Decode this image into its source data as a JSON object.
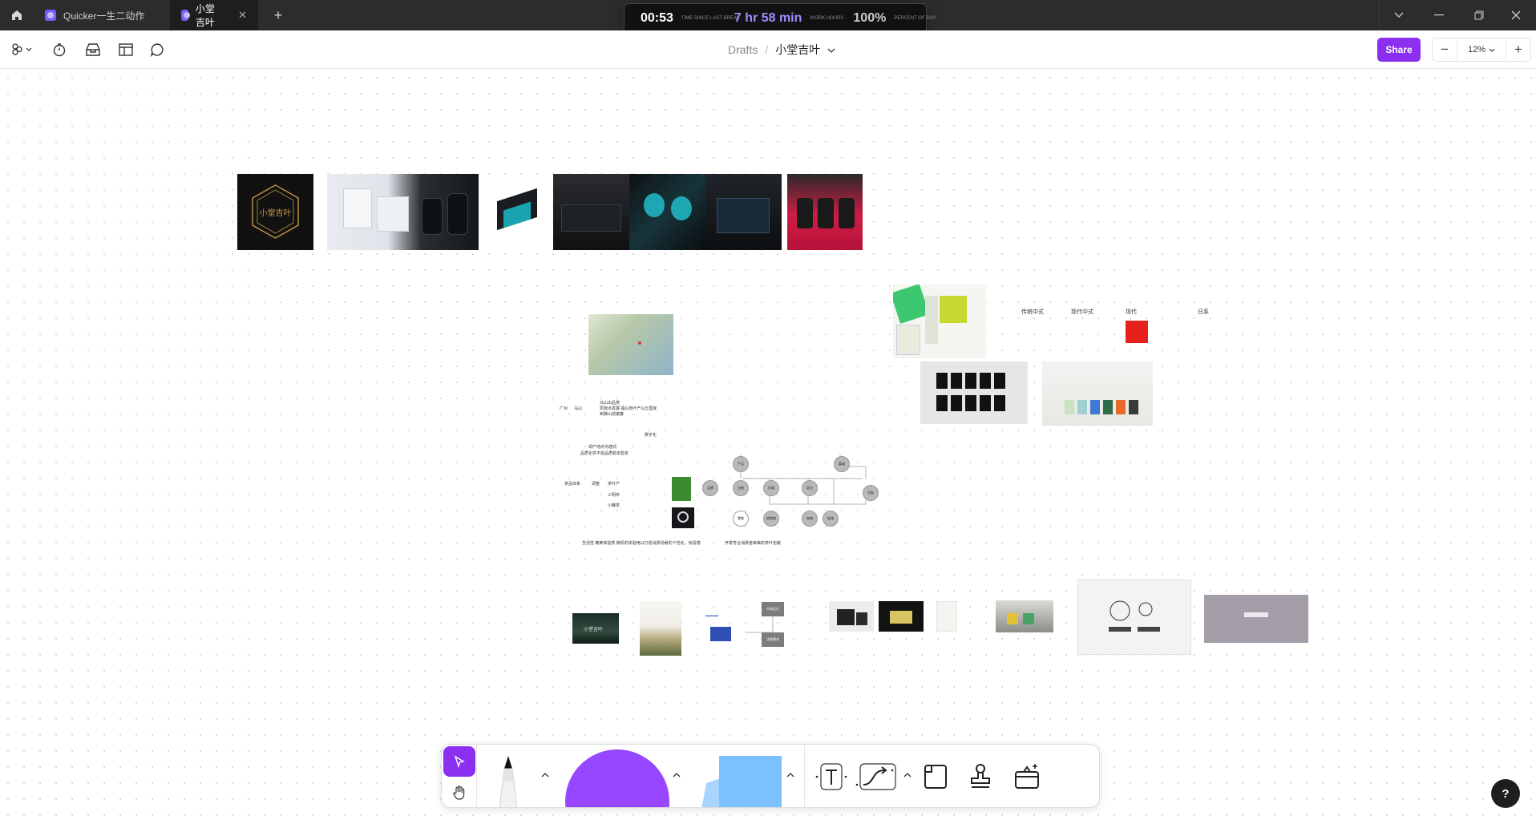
{
  "titlebar": {
    "tabs": [
      {
        "label": "Quicker一生二动作"
      },
      {
        "label": "小堂吉叶"
      }
    ]
  },
  "timer": {
    "since_break": "00:53",
    "since_break_label": "TIME SINCE LAST BREAK",
    "work_hours": "7 hr 58 min",
    "work_hours_label": "WORK HOURS",
    "percent": "100%",
    "percent_label": "PERCENT OF DAY"
  },
  "toolbar": {
    "breadcrumb_root": "Drafts",
    "breadcrumb_sep": "/",
    "file_name": "小堂吉叶",
    "share_label": "Share",
    "zoom": "12%"
  },
  "canvas": {
    "style_labels": [
      "传统中式",
      "现代中式",
      "现代",
      "日系"
    ],
    "logo_text": "小堂吉叶",
    "poster_text": "小堂吉叶",
    "map_notes": [
      "广州",
      "乌山",
      "乌山出品类",
      "原施点发展 福山地叶产山丘国家",
      "到陵山前镜春",
      "数字化",
      "现产地点沟通式",
      "品质化供不稳品质稳定稳定",
      "茶品体系",
      "调整",
      "茶叶产",
      "三明市",
      "小罐茶"
    ],
    "mind_nodes": [
      "产品",
      "品牌",
      "包装",
      "价值",
      "定位",
      "渠道",
      "目标",
      "零售",
      "经销商",
      "电商",
      "私域",
      "门店",
      "文化",
      "体验"
    ],
    "mind_footer_left": "生活性     精英体验类     随机的体验用以打造消费场景的个性化，惊喜感",
    "mind_footer_right": "开发符合消费者审美的茶叶包装",
    "box_labels": [
      "市场定位",
      "功能需求"
    ]
  },
  "help_label": "?"
}
